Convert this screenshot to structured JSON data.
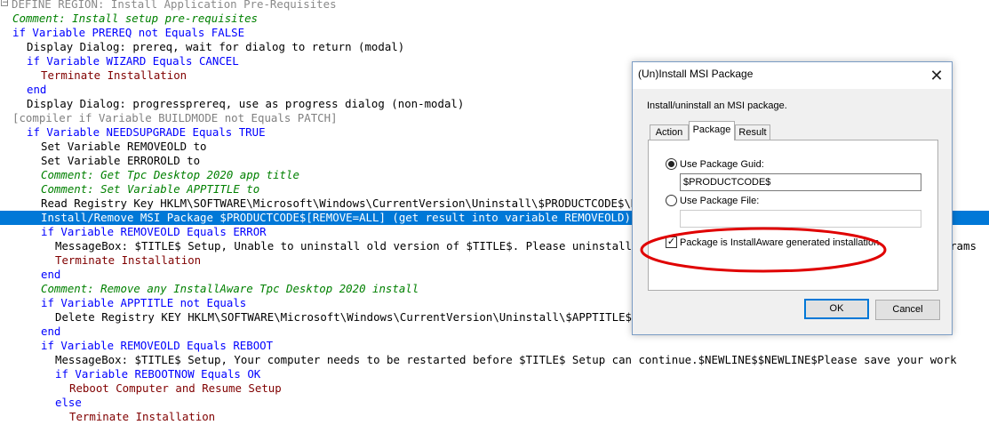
{
  "editor": {
    "lines": [
      {
        "text": "DEFINE REGION: Install Application Pre-Requisites",
        "color": "#8a8a8a",
        "italic": false,
        "indent": 1,
        "collapse": true
      },
      {
        "text": "Comment: Install setup pre-requisites",
        "color": "#008000",
        "italic": true,
        "indent": 1
      },
      {
        "text": "if Variable PREREQ not Equals FALSE",
        "color": "#0000ff",
        "italic": false,
        "indent": 1
      },
      {
        "text": "Display Dialog: prereq, wait for dialog to return (modal)",
        "color": "#000000",
        "italic": false,
        "indent": 2
      },
      {
        "text": "if Variable WIZARD Equals CANCEL",
        "color": "#0000ff",
        "italic": false,
        "indent": 2
      },
      {
        "text": "Terminate Installation",
        "color": "#800000",
        "italic": false,
        "indent": 3
      },
      {
        "text": "end",
        "color": "#0000ff",
        "italic": false,
        "indent": 2
      },
      {
        "text": "Display Dialog: progressprereq, use as progress dialog (non-modal)",
        "color": "#000000",
        "italic": false,
        "indent": 2
      },
      {
        "text": "[compiler if Variable BUILDMODE not Equals PATCH]",
        "color": "#808080",
        "italic": false,
        "indent": 1
      },
      {
        "text": "if Variable NEEDSUPGRADE Equals TRUE",
        "color": "#0000ff",
        "italic": false,
        "indent": 2
      },
      {
        "text": "Set Variable REMOVEOLD to",
        "color": "#000000",
        "italic": false,
        "indent": 3
      },
      {
        "text": "Set Variable ERROROLD to",
        "color": "#000000",
        "italic": false,
        "indent": 3
      },
      {
        "text": "Comment: Get Tpc Desktop 2020 app title",
        "color": "#008000",
        "italic": true,
        "indent": 3
      },
      {
        "text": "Comment: Set Variable APPTITLE to",
        "color": "#008000",
        "italic": true,
        "indent": 3
      },
      {
        "text": "Read Registry Key HKLM\\SOFTWARE\\Microsoft\\Windows\\CurrentVersion\\Uninstall\\$PRODUCTCODE$\\DisplayName into APPTITLE",
        "color": "#000000",
        "italic": false,
        "indent": 3
      },
      {
        "text": "Install/Remove MSI Package $PRODUCTCODE$[REMOVE=ALL] (get result into variable REMOVEOLD)",
        "color": "#ffffff",
        "italic": false,
        "indent": 3,
        "selected": true
      },
      {
        "text": "if Variable REMOVEOLD Equals ERROR",
        "color": "#0000ff",
        "italic": false,
        "indent": 3
      },
      {
        "text": "MessageBox: $TITLE$ Setup, Unable to uninstall old version of $TITLE$. Please uninstall it yourself using Control Panel Add-Remove Programs",
        "color": "#000000",
        "italic": false,
        "indent": 4
      },
      {
        "text": "Terminate Installation",
        "color": "#800000",
        "italic": false,
        "indent": 4
      },
      {
        "text": "end",
        "color": "#0000ff",
        "italic": false,
        "indent": 3
      },
      {
        "text": "Comment: Remove any InstallAware Tpc Desktop 2020 install",
        "color": "#008000",
        "italic": true,
        "indent": 3
      },
      {
        "text": "if Variable APPTITLE not Equals",
        "color": "#0000ff",
        "italic": false,
        "indent": 3
      },
      {
        "text": "Delete Registry KEY HKLM\\SOFTWARE\\Microsoft\\Windows\\CurrentVersion\\Uninstall\\$APPTITLE$",
        "color": "#000000",
        "italic": false,
        "indent": 4
      },
      {
        "text": "end",
        "color": "#0000ff",
        "italic": false,
        "indent": 3
      },
      {
        "text": "if Variable REMOVEOLD Equals REBOOT",
        "color": "#0000ff",
        "italic": false,
        "indent": 3
      },
      {
        "text": "MessageBox: $TITLE$ Setup, Your computer needs to be restarted before $TITLE$ Setup can continue.$NEWLINE$$NEWLINE$Please save your work",
        "color": "#000000",
        "italic": false,
        "indent": 4
      },
      {
        "text": "if Variable REBOOTNOW Equals OK",
        "color": "#0000ff",
        "italic": false,
        "indent": 4
      },
      {
        "text": "Reboot Computer and Resume Setup",
        "color": "#800000",
        "italic": false,
        "indent": 5
      },
      {
        "text": "else",
        "color": "#0000ff",
        "italic": false,
        "indent": 4
      },
      {
        "text": "Terminate Installation",
        "color": "#800000",
        "italic": false,
        "indent": 5
      }
    ]
  },
  "dialog": {
    "title": "(Un)Install MSI Package",
    "close_glyph": "✕",
    "description": "Install/uninstall an MSI package.",
    "tabs": {
      "action": "Action",
      "package": "Package",
      "result": "Result"
    },
    "use_guid_label": "Use Package Guid:",
    "guid_value": "$PRODUCTCODE$",
    "use_file_label": "Use Package File:",
    "file_value": "",
    "installaware_checkbox_label": "Package is InstallAware generated installation",
    "installaware_checked_glyph": "✓",
    "ok_label": "OK",
    "cancel_label": "Cancel"
  },
  "colors": {
    "selection": "#0078d7",
    "highlight_ellipse": "#e00000",
    "accent_button_border": "#0078d7"
  },
  "icons": {
    "collapse": "minus-box-icon",
    "close": "close-icon",
    "checkmark": "checkmark-icon",
    "radio_selected": "radio-selected-icon"
  }
}
